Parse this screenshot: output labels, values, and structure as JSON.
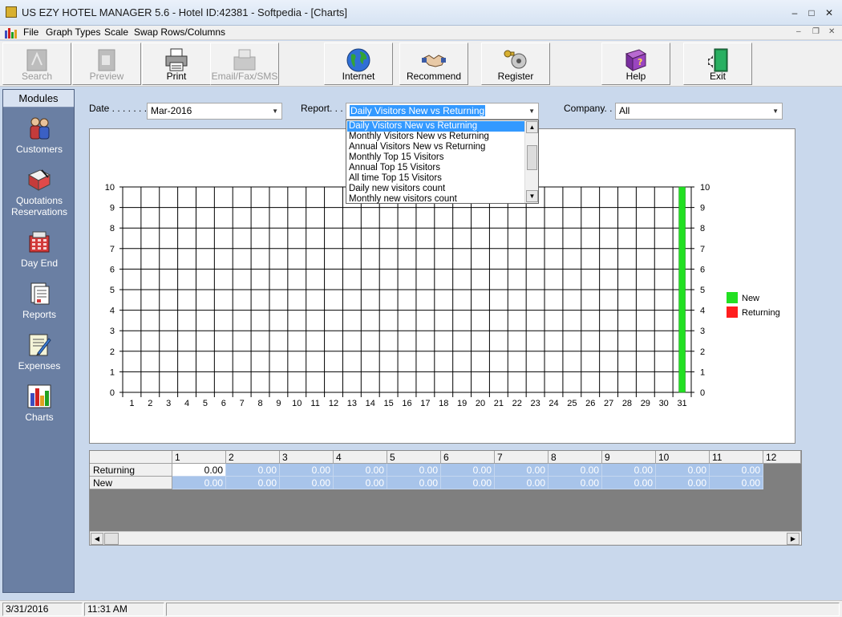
{
  "window": {
    "title": "US EZY HOTEL MANAGER 5.6 - Hotel ID:42381 - Softpedia - [Charts]"
  },
  "menu": {
    "items": [
      "File",
      "Graph Types",
      "Scale",
      "Swap Rows/Columns"
    ]
  },
  "toolbar": {
    "search": "Search",
    "preview": "Preview",
    "print": "Print",
    "email": "Email/Fax/SMS",
    "internet": "Internet",
    "recommend": "Recommend",
    "register": "Register",
    "help": "Help",
    "exit": "Exit"
  },
  "sidebar": {
    "header": "Modules",
    "items": [
      {
        "label": "Customers"
      },
      {
        "label": "Quotations\nReservations",
        "line1": "Quotations",
        "line2": "Reservations"
      },
      {
        "label": "Day End"
      },
      {
        "label": "Reports"
      },
      {
        "label": "Expenses"
      },
      {
        "label": "Charts"
      }
    ]
  },
  "filters": {
    "date_label": "Date . . . . . . . . .",
    "date_value": "Mar-2016",
    "report_label": "Report. . . . . .",
    "report_value": "Daily Visitors New vs Returning",
    "company_label": "Company. . . .",
    "company_value": "All"
  },
  "report_dropdown": {
    "options": [
      "Daily Visitors New vs Returning",
      "Monthly Visitors New vs Returning",
      "Annual Visitors New vs Returning",
      "Monthly Top 15 Visitors",
      "Annual Top 15 Visitors",
      "All time Top 15 Visitors",
      "Daily new visitors count",
      "Monthly new visitors count"
    ],
    "selected_index": 0
  },
  "chart_data": {
    "type": "bar",
    "categories": [
      "1",
      "2",
      "3",
      "4",
      "5",
      "6",
      "7",
      "8",
      "9",
      "10",
      "11",
      "12",
      "13",
      "14",
      "15",
      "16",
      "17",
      "18",
      "19",
      "20",
      "21",
      "22",
      "23",
      "24",
      "25",
      "26",
      "27",
      "28",
      "29",
      "30",
      "31"
    ],
    "series": [
      {
        "name": "Returning",
        "color": "#ff1e1e",
        "values": [
          0,
          0,
          0,
          0,
          0,
          0,
          0,
          0,
          0,
          0,
          0,
          0,
          0,
          0,
          0,
          0,
          0,
          0,
          0,
          0,
          0,
          0,
          0,
          0,
          0,
          0,
          0,
          0,
          0,
          0,
          0
        ]
      },
      {
        "name": "New",
        "color": "#22e022",
        "values": [
          0,
          0,
          0,
          0,
          0,
          0,
          0,
          0,
          0,
          0,
          0,
          0,
          0,
          0,
          0,
          0,
          0,
          0,
          0,
          0,
          0,
          0,
          0,
          0,
          0,
          0,
          0,
          0,
          0,
          0,
          10
        ]
      }
    ],
    "ylim": [
      0,
      10
    ],
    "yticks": [
      "0",
      "1",
      "2",
      "3",
      "4",
      "5",
      "6",
      "7",
      "8",
      "9",
      "10"
    ],
    "grid": true,
    "legend_position": "right"
  },
  "grid_table": {
    "columns": [
      "1",
      "2",
      "3",
      "4",
      "5",
      "6",
      "7",
      "8",
      "9",
      "10",
      "11",
      "12"
    ],
    "rows": [
      {
        "label": "Returning",
        "values": [
          "0.00",
          "0.00",
          "0.00",
          "0.00",
          "0.00",
          "0.00",
          "0.00",
          "0.00",
          "0.00",
          "0.00",
          "0.00"
        ]
      },
      {
        "label": "New",
        "values": [
          "0.00",
          "0.00",
          "0.00",
          "0.00",
          "0.00",
          "0.00",
          "0.00",
          "0.00",
          "0.00",
          "0.00",
          "0.00"
        ]
      }
    ]
  },
  "status": {
    "date": "3/31/2016",
    "time": "11:31 AM"
  }
}
